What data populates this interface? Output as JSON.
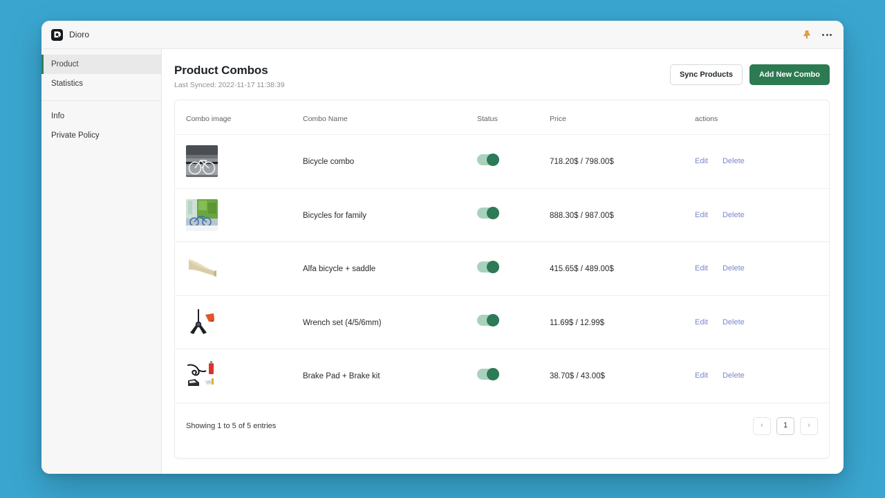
{
  "window": {
    "brand_name": "Dioro",
    "logo_icon": "dioro-logo-icon",
    "pin_icon": "pin-icon",
    "more_icon": "more-options-icon"
  },
  "sidebar": {
    "groups": [
      {
        "items": [
          {
            "label": "Product",
            "active": true
          },
          {
            "label": "Statistics",
            "active": false
          }
        ]
      },
      {
        "items": [
          {
            "label": "Info",
            "active": false
          },
          {
            "label": "Private Policy",
            "active": false
          }
        ]
      }
    ]
  },
  "header": {
    "title": "Product Combos",
    "subtitle": "Last Synced: 2022-11-17 11:38:39",
    "sync_button": "Sync Products",
    "add_button": "Add New Combo"
  },
  "table": {
    "columns": [
      "Combo image",
      "Combo Name",
      "Status",
      "Price",
      "actions"
    ],
    "rows": [
      {
        "image": "bicycle-photo-grayscale",
        "name": "Bicycle combo",
        "status_on": true,
        "price": "718.20$ / 798.00$",
        "edit": "Edit",
        "delete": "Delete"
      },
      {
        "image": "bicycles-greenery-photo",
        "name": "Bicycles for family",
        "status_on": true,
        "price": "888.30$ / 987.00$",
        "edit": "Edit",
        "delete": "Delete"
      },
      {
        "image": "saddle-photo",
        "name": "Alfa bicycle + saddle",
        "status_on": true,
        "price": "415.65$ / 489.00$",
        "edit": "Edit",
        "delete": "Delete"
      },
      {
        "image": "wrench-set-photo",
        "name": "Wrench set (4/5/6mm)",
        "status_on": true,
        "price": "11.69$ / 12.99$",
        "edit": "Edit",
        "delete": "Delete"
      },
      {
        "image": "brake-kit-photo",
        "name": "Brake Pad + Brake kit",
        "status_on": true,
        "price": "38.70$ / 43.00$",
        "edit": "Edit",
        "delete": "Delete"
      }
    ]
  },
  "footer": {
    "entries_text": "Showing 1 to 5 of 5 entries",
    "prev_label": "‹",
    "page_label": "1",
    "next_label": "›"
  },
  "colors": {
    "desktop_background": "#3aa6d0",
    "accent_green": "#2c7a52",
    "toggle_track": "#a8d2bd",
    "toggle_knob": "#2d7a57",
    "link_blue": "#7b85cd"
  }
}
